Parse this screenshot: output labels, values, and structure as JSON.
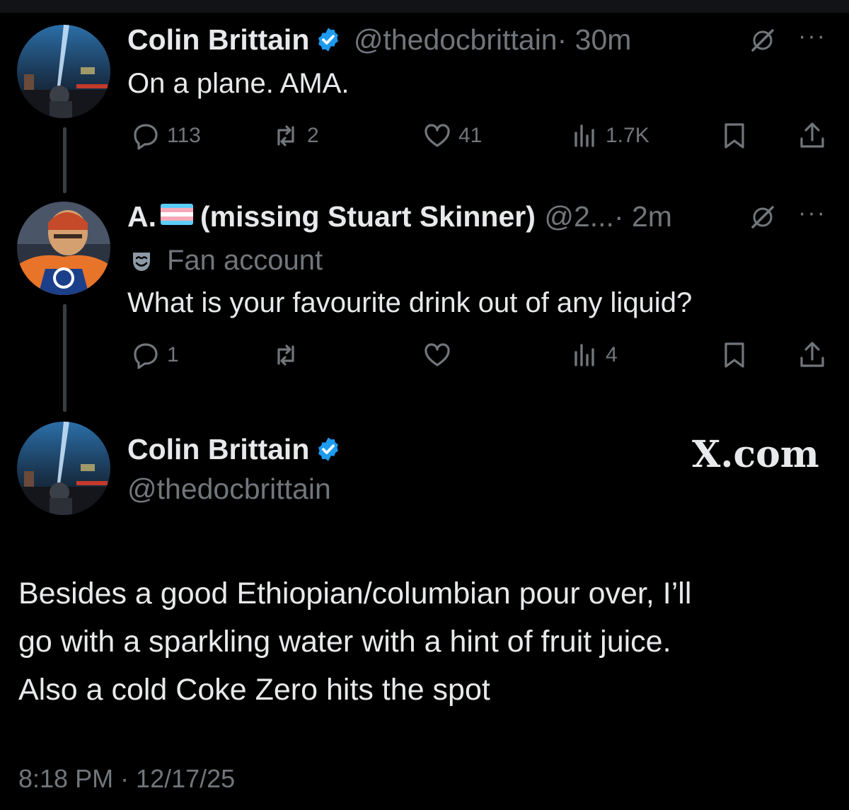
{
  "tweet1": {
    "name": "Colin Brittain",
    "handle": "@thedocbrittain",
    "time": "· 30m",
    "text": "On a plane.  AMA.",
    "replies": "113",
    "reposts": "2",
    "likes": "41",
    "views": "1.7K"
  },
  "tweet2": {
    "name_prefix": "A.",
    "name_suffix": "(missing Stuart Skinner)",
    "handle": "@2...",
    "time": "· 2m",
    "label": "Fan account",
    "text": "What is your favourite drink out of any liquid?",
    "replies": "1",
    "reposts": "",
    "likes": "",
    "views": "4"
  },
  "main": {
    "name": "Colin Brittain",
    "handle": "@thedocbrittain",
    "brand": "X.com",
    "lines": [
      "Besides a good Ethiopian/columbian pour over,  I’ll",
      "go with a sparkling water with a hint of fruit juice.",
      "Also a cold Coke Zero hits the spot"
    ],
    "timestamp": "8:18 PM · 12/17/25"
  },
  "icons": {
    "more": "more-dots-icon",
    "grok": "grok-icon",
    "verified": "verified-badge-icon"
  },
  "colors": {
    "background": "#000000",
    "text": "#e7e9ea",
    "secondary": "#71767b",
    "verified": "#1d9bf0"
  },
  "more_glyph": "···"
}
